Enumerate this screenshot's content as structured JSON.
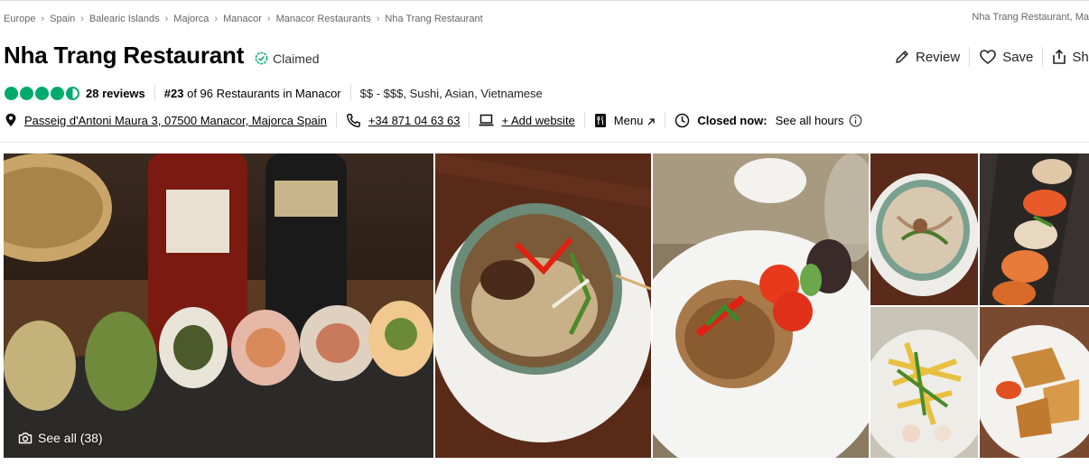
{
  "breadcrumb": {
    "items": [
      "Europe",
      "Spain",
      "Balearic Islands",
      "Majorca",
      "Manacor",
      "Manacor Restaurants",
      "Nha Trang Restaurant"
    ],
    "right_text": "Nha Trang Restaurant, Ma"
  },
  "restaurant": {
    "name": "Nha Trang Restaurant",
    "claimed_label": "Claimed"
  },
  "actions": {
    "review_label": "Review",
    "save_label": "Save",
    "share_label": "Sha"
  },
  "rating": {
    "value": 4.5,
    "max": 5,
    "reviews_label": "28 reviews",
    "rank_number": "#23",
    "rank_text": " of 96 Restaurants in Manacor",
    "price_cuisine": "$$ - $$$, Sushi, Asian, Vietnamese"
  },
  "info": {
    "address": "Passeig d'Antoni Maura 3, 07500 Manacor, Majorca Spain",
    "phone": "+34 871 04 63 63",
    "website_label": "+ Add website",
    "menu_label": "Menu",
    "closed_label": "Closed now:",
    "hours_label": "See all hours"
  },
  "gallery": {
    "see_all_label": "See all (38)",
    "photos": [
      {
        "subject": "sushi rolls with bottles"
      },
      {
        "subject": "pho noodle soup"
      },
      {
        "subject": "fried rice with tomatoes"
      },
      {
        "subject": "noodle soup bowl"
      },
      {
        "subject": "sushi platter"
      },
      {
        "subject": "mango salad"
      },
      {
        "subject": "fried spring rolls"
      }
    ]
  },
  "colors": {
    "rating_green": "#00aa6c",
    "text_primary": "#000000",
    "text_muted": "#666666"
  }
}
